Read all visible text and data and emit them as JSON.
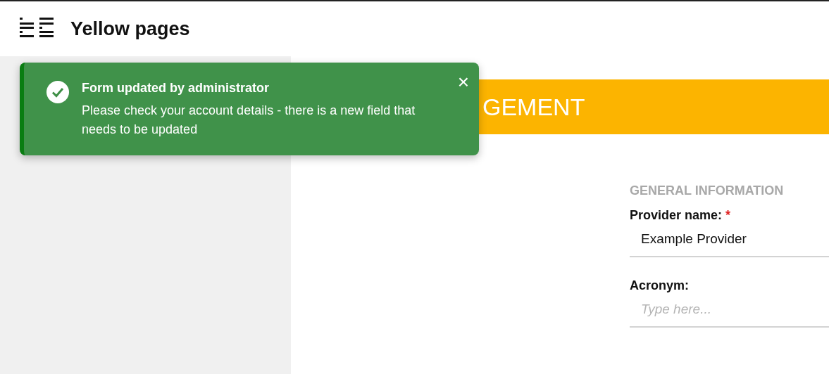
{
  "header": {
    "title": "Yellow pages"
  },
  "banner": {
    "title": "GEMENT"
  },
  "toast": {
    "title": "Form updated by administrator",
    "message": "Please check your account details - there is a new field that needs to be updated",
    "close": "×"
  },
  "form": {
    "section": "GENERAL INFORMATION",
    "fields": [
      {
        "label": "Provider name:",
        "required_mark": "*",
        "value": "Example Provider"
      },
      {
        "label": "Acronym:",
        "placeholder": "Type here..."
      }
    ]
  }
}
